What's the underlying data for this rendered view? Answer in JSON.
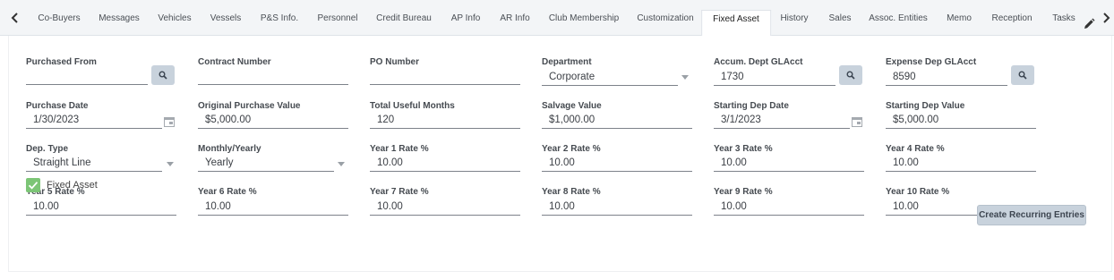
{
  "tabs": [
    {
      "label": "Co-Buyers"
    },
    {
      "label": "Messages"
    },
    {
      "label": "Vehicles"
    },
    {
      "label": "Vessels"
    },
    {
      "label": "P&S Info."
    },
    {
      "label": "Personnel"
    },
    {
      "label": "Credit Bureau"
    },
    {
      "label": "AP Info"
    },
    {
      "label": "AR Info"
    },
    {
      "label": "Club Membership"
    },
    {
      "label": "Customization"
    },
    {
      "label": "Fixed Asset"
    },
    {
      "label": "History"
    },
    {
      "label": "Sales"
    },
    {
      "label": "Assoc. Entities"
    },
    {
      "label": "Memo"
    },
    {
      "label": "Reception"
    },
    {
      "label": "Tasks"
    }
  ],
  "active_tab": "Fixed Asset",
  "icons": {
    "prev": "chevron-left-icon",
    "next": "chevron-right-icon",
    "edit": "pencil-icon",
    "search": "magnifier-icon",
    "calendar": "calendar-icon",
    "check": "checkmark-icon"
  },
  "colors": {
    "search_button": "#c8d2dc",
    "checkbox": "#7cc576",
    "create_button": "#c8d2dc"
  },
  "form": {
    "purchased_from": {
      "label": "Purchased From",
      "value": ""
    },
    "contract_number": {
      "label": "Contract Number",
      "value": ""
    },
    "po_number": {
      "label": "PO Number",
      "value": ""
    },
    "department": {
      "label": "Department",
      "value": "Corporate"
    },
    "accum_dept_glacct": {
      "label": "Accum. Dept GLAcct",
      "value": "1730"
    },
    "expense_dep_glacct": {
      "label": "Expense Dep GLAcct",
      "value": "8590"
    },
    "purchase_date": {
      "label": "Purchase Date",
      "value": "1/30/2023"
    },
    "original_purchase_value": {
      "label": "Original Purchase Value",
      "value": "$5,000.00"
    },
    "total_useful_months": {
      "label": "Total Useful Months",
      "value": "120"
    },
    "salvage_value": {
      "label": "Salvage Value",
      "value": "$1,000.00"
    },
    "starting_dep_date": {
      "label": "Starting Dep Date",
      "value": "3/1/2023"
    },
    "starting_dep_value": {
      "label": "Starting Dep Value",
      "value": "$5,000.00"
    },
    "dep_type": {
      "label": "Dep. Type",
      "value": "Straight Line"
    },
    "monthly_yearly": {
      "label": "Monthly/Yearly",
      "value": "Yearly"
    },
    "year1_rate": {
      "label": "Year 1 Rate %",
      "value": "10.00"
    },
    "year2_rate": {
      "label": "Year 2 Rate %",
      "value": "10.00"
    },
    "year3_rate": {
      "label": "Year 3 Rate %",
      "value": "10.00"
    },
    "year4_rate": {
      "label": "Year 4 Rate %",
      "value": "10.00"
    },
    "year5_rate": {
      "label": "Year 5 Rate %",
      "value": "10.00"
    },
    "year6_rate": {
      "label": "Year 6 Rate %",
      "value": "10.00"
    },
    "year7_rate": {
      "label": "Year 7 Rate %",
      "value": "10.00"
    },
    "year8_rate": {
      "label": "Year 8 Rate %",
      "value": "10.00"
    },
    "year9_rate": {
      "label": "Year 9 Rate %",
      "value": "10.00"
    },
    "year10_rate": {
      "label": "Year 10 Rate %",
      "value": "10.00"
    },
    "fixed_asset": {
      "label": "Fixed Asset",
      "checked": true
    }
  },
  "actions": {
    "create_recurring": "Create Recurring Entries"
  }
}
